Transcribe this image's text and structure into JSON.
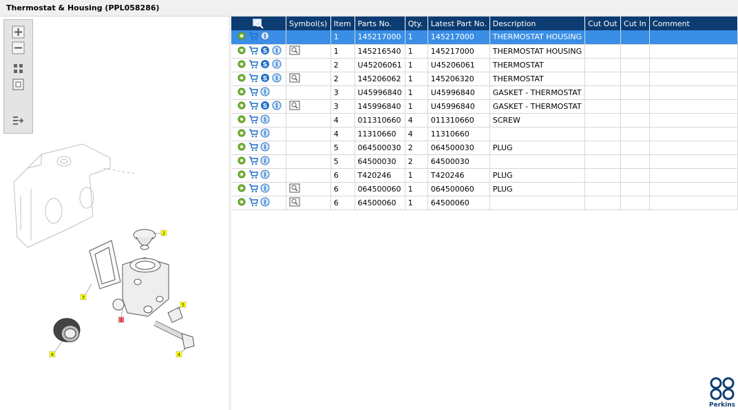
{
  "window": {
    "title": "Thermostat & Housing (PPL058286)"
  },
  "grid": {
    "columns": [
      "",
      "Symbol(s)",
      "Item",
      "Parts No.",
      "Qty.",
      "Latest Part No.",
      "Description",
      "Cut Out",
      "Cut In",
      "Comment"
    ],
    "rows": [
      {
        "item": "1",
        "part_no": "145217000",
        "qty": "1",
        "latest": "145217000",
        "desc": "THERMOSTAT HOUSING",
        "cut_out": "",
        "cut_in": "",
        "comment": "",
        "s_icon": false,
        "symbol": false,
        "selected": true
      },
      {
        "item": "1",
        "part_no": "145216540",
        "qty": "1",
        "latest": "145217000",
        "desc": "THERMOSTAT HOUSING",
        "cut_out": "",
        "cut_in": "",
        "comment": "",
        "s_icon": true,
        "symbol": true,
        "selected": false
      },
      {
        "item": "2",
        "part_no": "U45206061",
        "qty": "1",
        "latest": "U45206061",
        "desc": "THERMOSTAT",
        "cut_out": "",
        "cut_in": "",
        "comment": "",
        "s_icon": true,
        "symbol": false,
        "selected": false
      },
      {
        "item": "2",
        "part_no": "145206062",
        "qty": "1",
        "latest": "145206320",
        "desc": "THERMOSTAT",
        "cut_out": "",
        "cut_in": "",
        "comment": "",
        "s_icon": true,
        "symbol": true,
        "selected": false
      },
      {
        "item": "3",
        "part_no": "U45996840",
        "qty": "1",
        "latest": "U45996840",
        "desc": "GASKET - THERMOSTAT",
        "cut_out": "",
        "cut_in": "",
        "comment": "",
        "s_icon": false,
        "symbol": false,
        "selected": false
      },
      {
        "item": "3",
        "part_no": "145996840",
        "qty": "1",
        "latest": "U45996840",
        "desc": "GASKET - THERMOSTAT",
        "cut_out": "",
        "cut_in": "",
        "comment": "",
        "s_icon": true,
        "symbol": true,
        "selected": false
      },
      {
        "item": "4",
        "part_no": "011310660",
        "qty": "4",
        "latest": "011310660",
        "desc": "SCREW",
        "cut_out": "",
        "cut_in": "",
        "comment": "",
        "s_icon": false,
        "symbol": false,
        "selected": false
      },
      {
        "item": "4",
        "part_no": "11310660",
        "qty": "4",
        "latest": "11310660",
        "desc": "",
        "cut_out": "",
        "cut_in": "",
        "comment": "",
        "s_icon": false,
        "symbol": false,
        "selected": false
      },
      {
        "item": "5",
        "part_no": "064500030",
        "qty": "2",
        "latest": "064500030",
        "desc": "PLUG",
        "cut_out": "",
        "cut_in": "",
        "comment": "",
        "s_icon": false,
        "symbol": false,
        "selected": false
      },
      {
        "item": "5",
        "part_no": "64500030",
        "qty": "2",
        "latest": "64500030",
        "desc": "",
        "cut_out": "",
        "cut_in": "",
        "comment": "",
        "s_icon": false,
        "symbol": false,
        "selected": false
      },
      {
        "item": "6",
        "part_no": "T420246",
        "qty": "1",
        "latest": "T420246",
        "desc": "PLUG",
        "cut_out": "",
        "cut_in": "",
        "comment": "",
        "s_icon": false,
        "symbol": false,
        "selected": false
      },
      {
        "item": "6",
        "part_no": "064500060",
        "qty": "1",
        "latest": "064500060",
        "desc": "PLUG",
        "cut_out": "",
        "cut_in": "",
        "comment": "",
        "s_icon": false,
        "symbol": true,
        "selected": false
      },
      {
        "item": "6",
        "part_no": "64500060",
        "qty": "1",
        "latest": "64500060",
        "desc": "",
        "cut_out": "",
        "cut_in": "",
        "comment": "",
        "s_icon": false,
        "symbol": true,
        "selected": false
      }
    ]
  },
  "diagram": {
    "callouts": [
      {
        "label": "2",
        "color": "#ffff00"
      },
      {
        "label": "3",
        "color": "#ffff00"
      },
      {
        "label": "1",
        "color": "#ff6b6b"
      },
      {
        "label": "5",
        "color": "#ffff00"
      },
      {
        "label": "4",
        "color": "#ffff00"
      },
      {
        "label": "6",
        "color": "#ffff00"
      }
    ]
  },
  "toolbar": {
    "buttons": [
      "zoom-in-icon",
      "zoom-out-icon",
      "fit-view-icon",
      "actual-size-icon",
      "export-list-icon"
    ]
  },
  "brand": {
    "logo_text": "Perkins"
  },
  "colors": {
    "header_bg": "#0d3c72",
    "selected_row": "#3a8ee6",
    "callout": "#ffff00"
  }
}
